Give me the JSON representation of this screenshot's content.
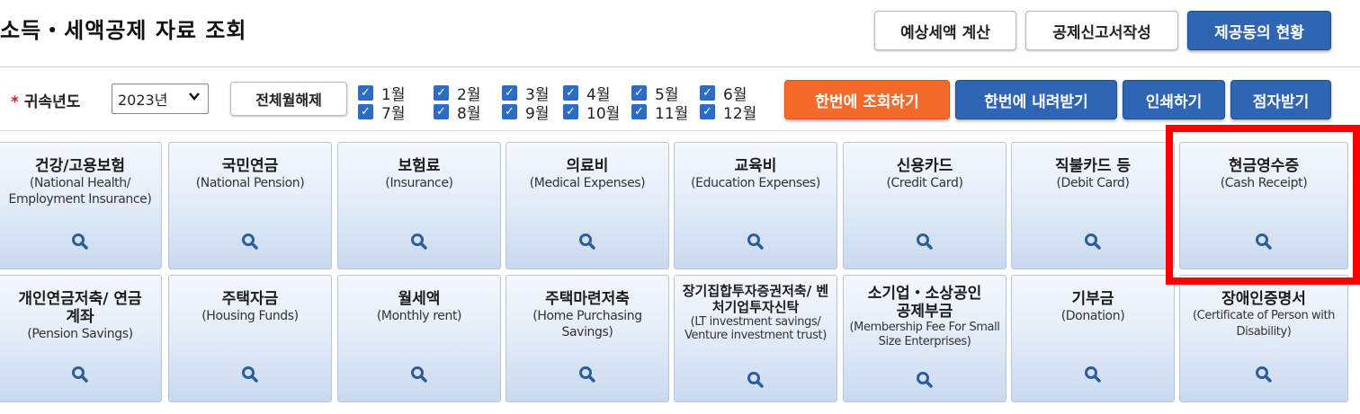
{
  "page_title": "소득・세액공제 자료 조회",
  "top_buttons": {
    "estimate": "예상세액 계산",
    "deduction_report": "공제신고서작성",
    "consent_status": "제공동의 현황"
  },
  "filter": {
    "required_mark": "*",
    "year_label": "귀속년도",
    "year_value": "2023년",
    "deselect_all": "전체월해제",
    "months": [
      "1월",
      "2월",
      "3월",
      "4월",
      "5월",
      "6월",
      "7월",
      "8월",
      "9월",
      "10월",
      "11월",
      "12월"
    ],
    "months_checked": true
  },
  "actions": {
    "query_all": "한번에 조회하기",
    "download_all": "한번에 내려받기",
    "print": "인쇄하기",
    "braille": "점자받기"
  },
  "cards": [
    {
      "title": "건강/고용보험",
      "sub": "(National Health/ Employment Insurance)"
    },
    {
      "title": "국민연금",
      "sub": "(National Pension)"
    },
    {
      "title": "보험료",
      "sub": "(Insurance)"
    },
    {
      "title": "의료비",
      "sub": "(Medical Expenses)"
    },
    {
      "title": "교육비",
      "sub": "(Education Expenses)"
    },
    {
      "title": "신용카드",
      "sub": "(Credit Card)"
    },
    {
      "title": "직불카드 등",
      "sub": "(Debit Card)"
    },
    {
      "title": "현금영수증",
      "sub": "(Cash Receipt)"
    },
    {
      "title": "개인연금저축/ 연금계좌",
      "sub": "(Pension Savings)"
    },
    {
      "title": "주택자금",
      "sub": "(Housing Funds)"
    },
    {
      "title": "월세액",
      "sub": "(Monthly rent)"
    },
    {
      "title": "주택마련저축",
      "sub": "(Home Purchasing Savings)"
    },
    {
      "title": "장기집합투자증권저축/ 벤처기업투자신탁",
      "sub": "(LT investment savings/ Venture investment trust)"
    },
    {
      "title": "소기업・소상공인 공제부금",
      "sub": "(Membership Fee For Small Size Enterprises)"
    },
    {
      "title": "기부금",
      "sub": "(Donation)"
    },
    {
      "title": "장애인증명서",
      "sub": "(Certificate of Person with Disability)"
    }
  ],
  "colors": {
    "primary_blue": "#2f66b3",
    "orange": "#f36a2b",
    "highlight_red": "#ff0000",
    "checkbox_blue": "#2b6cc4"
  },
  "icons": {
    "card_icon": "search-icon",
    "year_dropdown": "chevron-down-icon",
    "month_checkbox": "checkmark-icon"
  }
}
